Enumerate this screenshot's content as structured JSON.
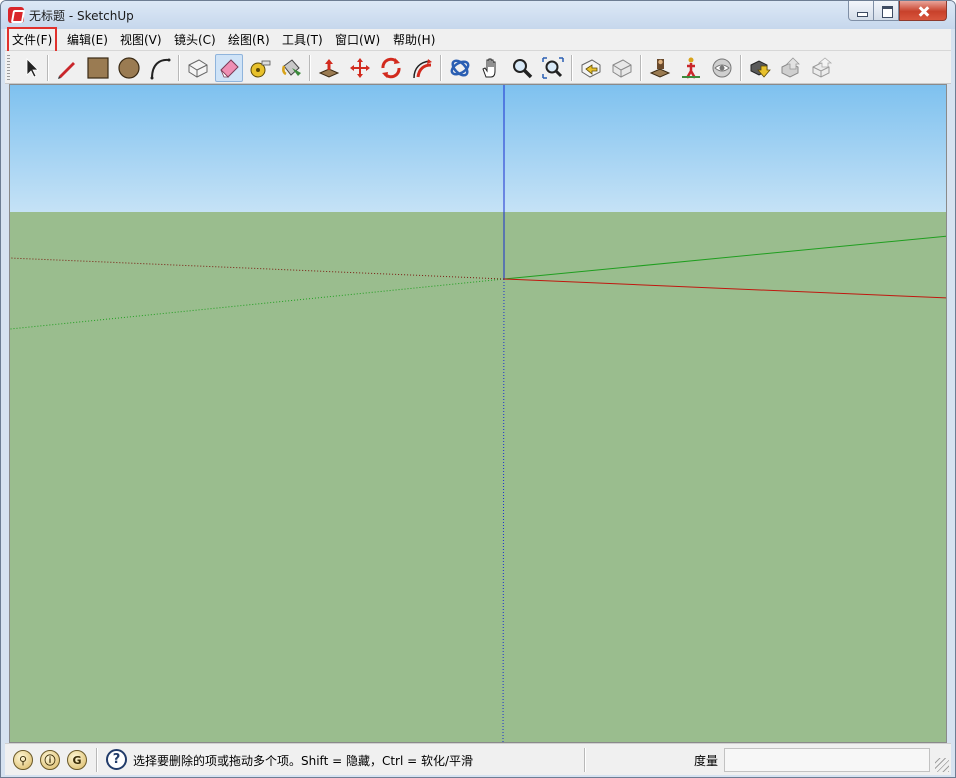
{
  "window": {
    "title": "无标题 - SketchUp",
    "app_icon": "sketchup-icon",
    "controls": [
      "minimize-icon",
      "maximize-icon",
      "close-icon"
    ]
  },
  "menubar": {
    "items": [
      {
        "label": "文件(F)",
        "highlighted": true
      },
      {
        "label": "编辑(E)"
      },
      {
        "label": "视图(V)"
      },
      {
        "label": "镜头(C)"
      },
      {
        "label": "绘图(R)"
      },
      {
        "label": "工具(T)"
      },
      {
        "label": "窗口(W)"
      },
      {
        "label": "帮助(H)"
      }
    ],
    "highlight_color": "#e0312c"
  },
  "toolbar": {
    "tools": [
      "select-icon",
      "pencil-icon",
      "rectangle-icon",
      "circle-icon",
      "arc-icon",
      "make-component-icon",
      "eraser-icon",
      "tape-measure-icon",
      "paint-bucket-icon",
      "push-pull-icon",
      "move-icon",
      "rotate-icon",
      "follow-me-icon",
      "orbit-icon",
      "pan-icon",
      "zoom-icon",
      "zoom-extents-icon",
      "previous-view-icon",
      "next-view-icon",
      "position-camera-icon",
      "walk-icon",
      "look-around-icon",
      "get-models-icon",
      "share-model-icon",
      "share-component-icon"
    ],
    "active_tool": "eraser-icon"
  },
  "viewport": {
    "sky_color": "#7ec1ef",
    "ground_color": "#9abd8e",
    "axis_colors": {
      "red": "#c0170f",
      "green": "#1f9e1f",
      "blue": "#1a2fd0"
    }
  },
  "statusbar": {
    "instructor_icons": [
      "geo-location-icon",
      "credits-icon",
      "account-icon"
    ],
    "help_icon": "help-icon",
    "message": "选择要删除的项或拖动多个项。Shift = 隐藏，Ctrl = 软化/平滑",
    "measure_label": "度量",
    "measure_value": ""
  }
}
